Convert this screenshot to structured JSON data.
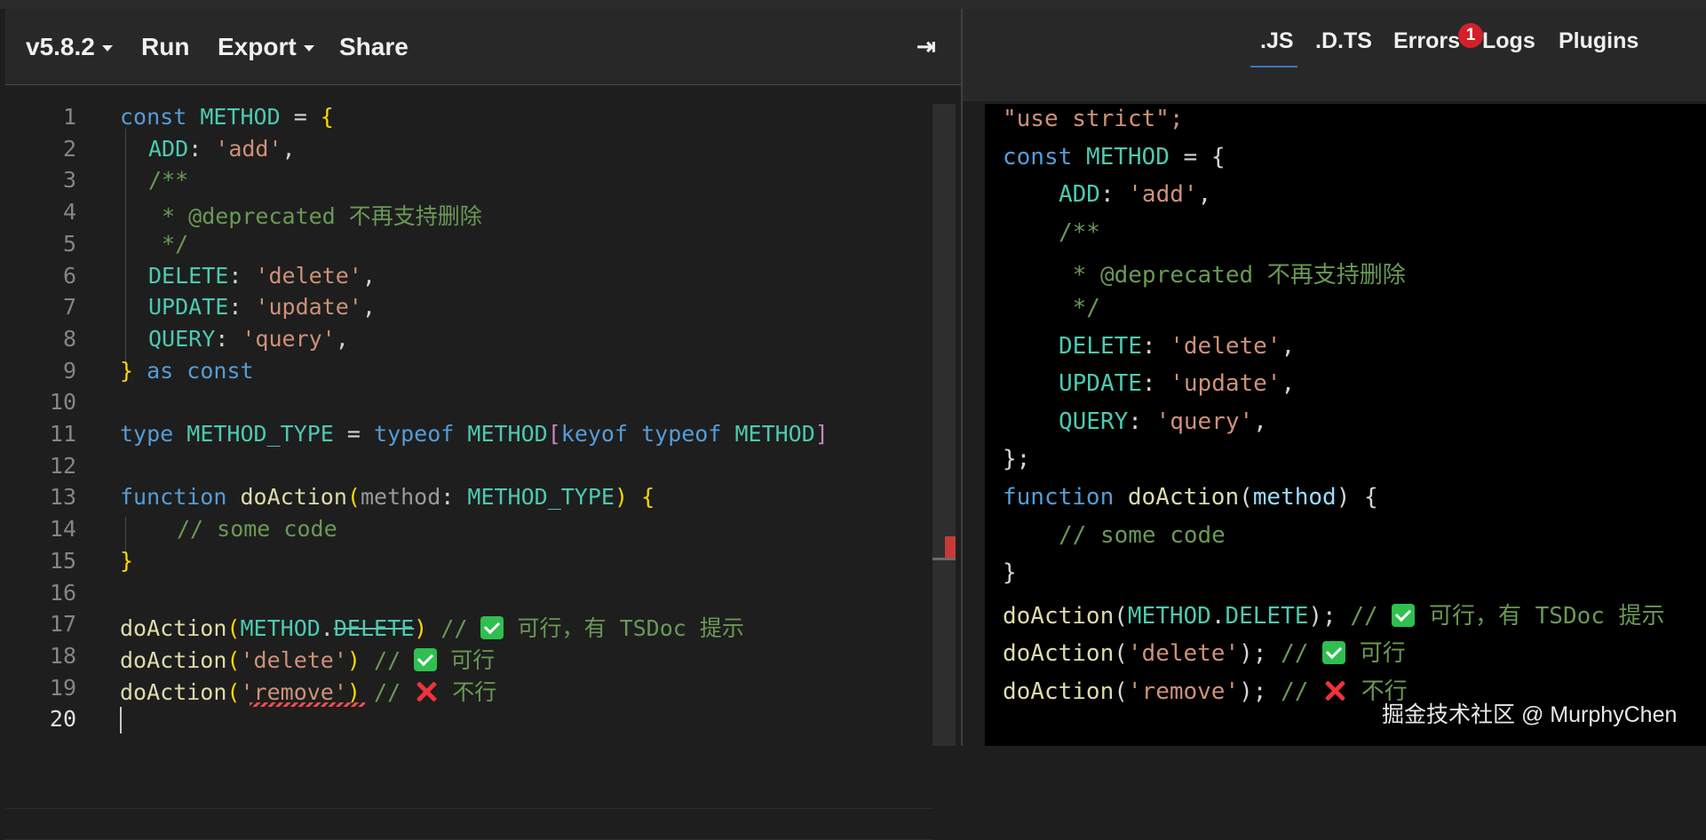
{
  "toolbar": {
    "version": "v5.8.2",
    "run": "Run",
    "export": "Export",
    "share": "Share",
    "collapse_icon": "⇥"
  },
  "output_tabs": {
    "js": ".JS",
    "dts": ".D.TS",
    "errors": "Errors",
    "errors_badge": "1",
    "logs": "Logs",
    "plugins": "Plugins"
  },
  "editor": {
    "line_numbers": [
      "1",
      "2",
      "3",
      "4",
      "5",
      "6",
      "7",
      "8",
      "9",
      "10",
      "11",
      "12",
      "13",
      "14",
      "15",
      "16",
      "17",
      "18",
      "19",
      "20"
    ],
    "tokens": {
      "const": "const",
      "method": "METHOD",
      "eq": " = ",
      "lbrace": "{",
      "add_key": "ADD",
      "add_val": "'add'",
      "colon": ": ",
      "comma": ",",
      "doc_open": "/**",
      "doc_tag": " * @deprecated 不再支持删除",
      "doc_close": " */",
      "delete_key": "DELETE",
      "delete_val": "'delete'",
      "update_key": "UPDATE",
      "update_val": "'update'",
      "query_key": "QUERY",
      "query_val": "'query'",
      "rbrace": "}",
      "as": "as",
      "type": "type",
      "method_type": "METHOD_TYPE",
      "lbracket": "[",
      "rbracket": "]",
      "keyof": "keyof",
      "typeof": "typeof",
      "function": "function",
      "do_action": "doAction",
      "lparen": "(",
      "rparen": ")",
      "param": "method",
      "some_code": "// some code",
      "dot": ".",
      "remove_val": "'remove'",
      "comment_slash": "// ",
      "comment_ok_tsdoc": "可行，有 TSDoc 提示",
      "comment_ok": "可行",
      "comment_no": "不行"
    }
  },
  "output": {
    "use_strict": "\"use strict\";",
    "semicolon": ";",
    "close_obj": "};"
  },
  "icons": {
    "check": "check-mark-icon",
    "cross": "cross-mark-icon"
  },
  "watermark": "掘金技术社区 @ MurphyChen"
}
